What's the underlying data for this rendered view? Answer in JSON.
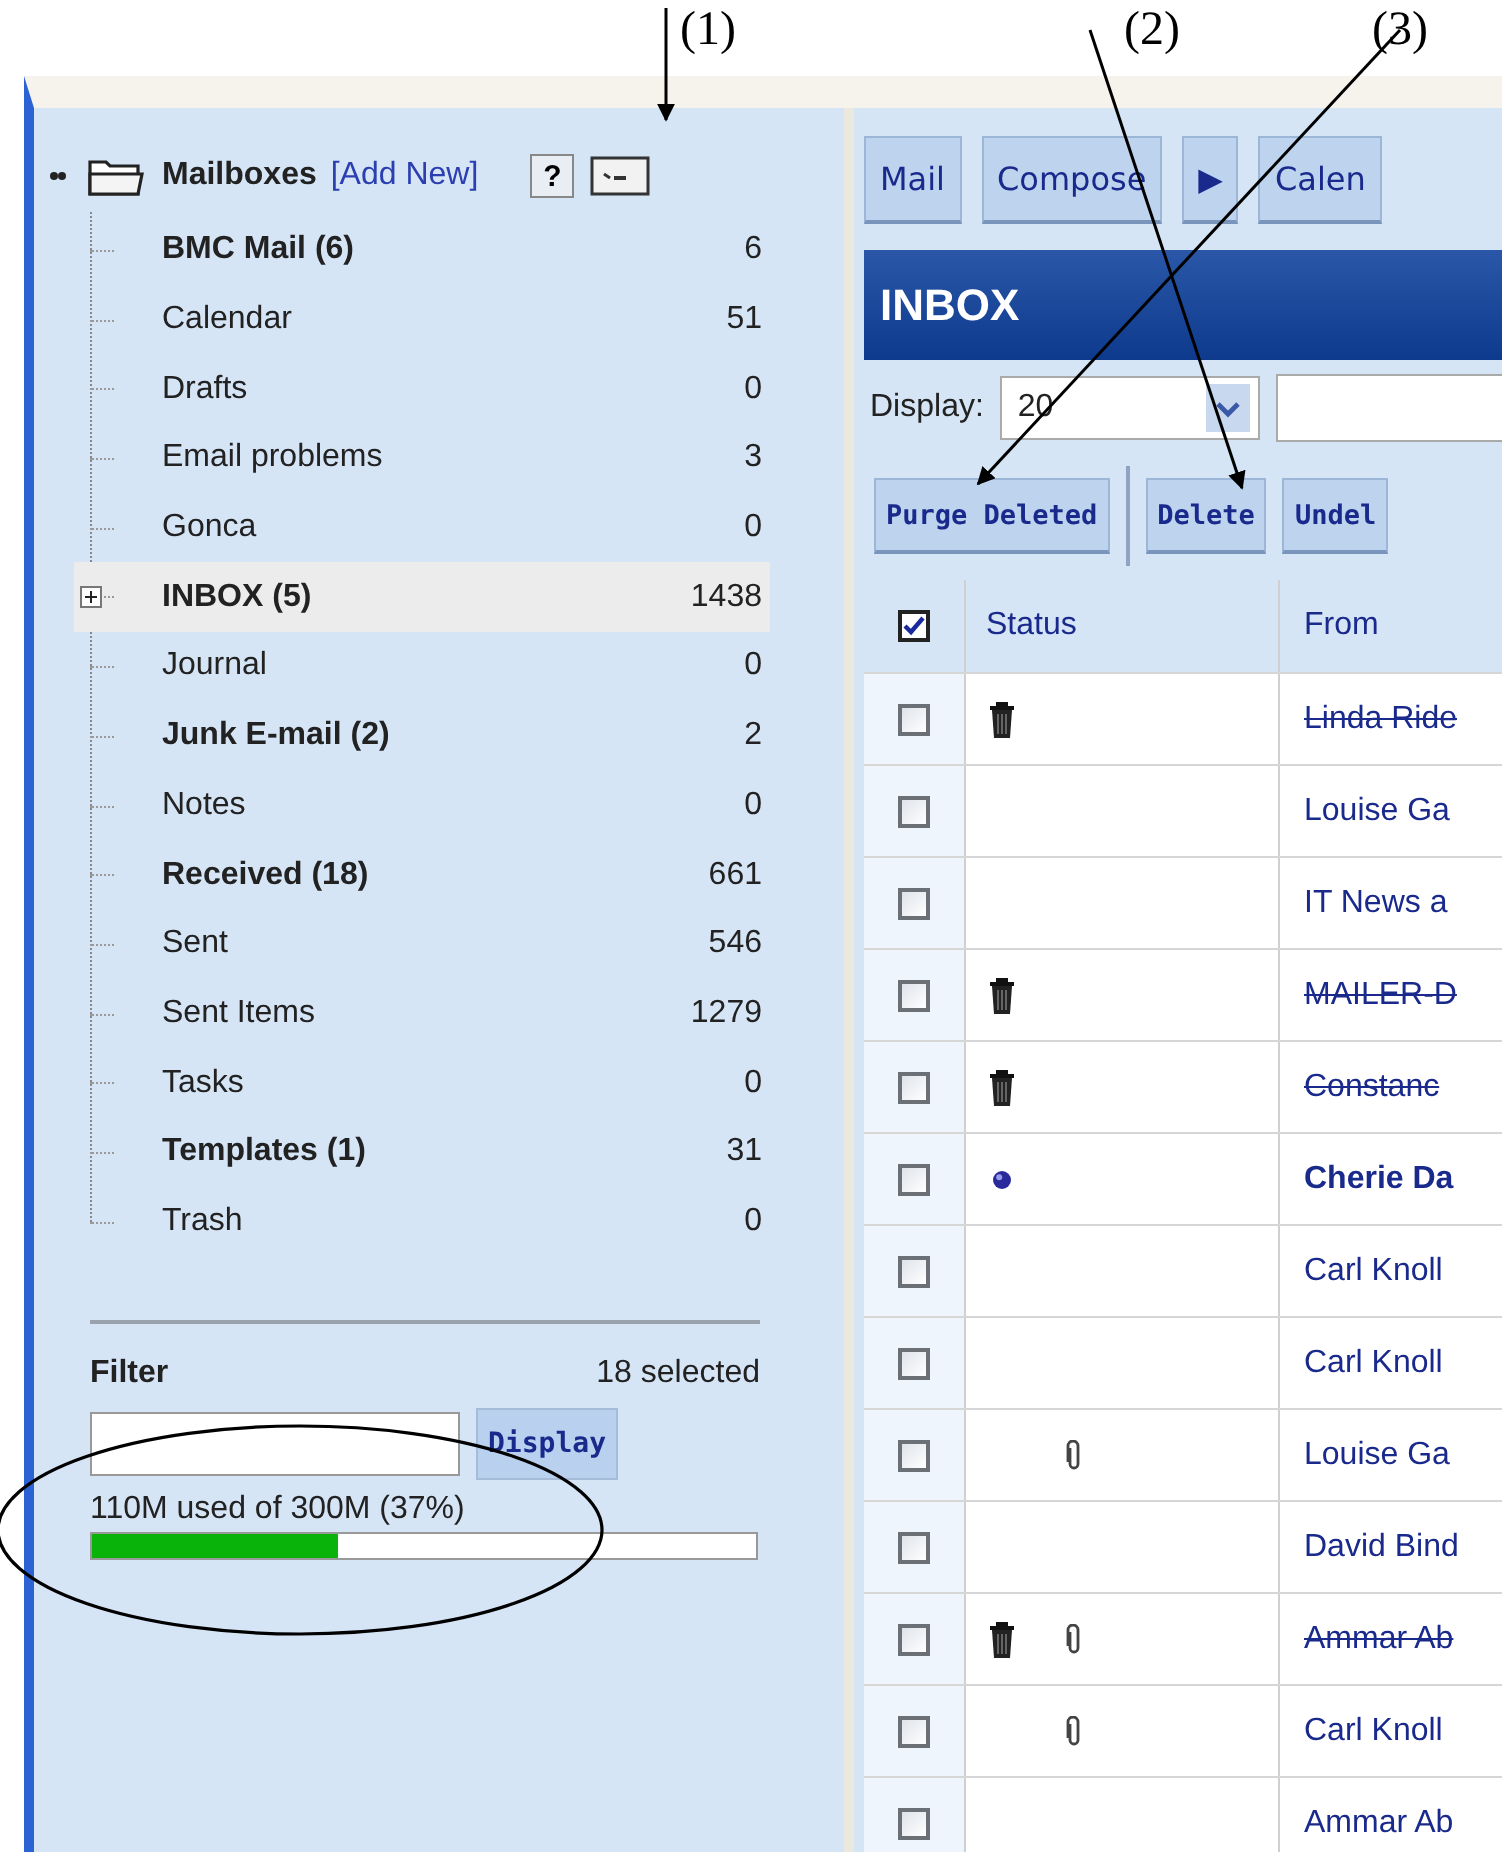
{
  "annotations": [
    {
      "label": "(1)"
    },
    {
      "label": "(2)"
    },
    {
      "label": "(3)"
    }
  ],
  "sidebar": {
    "title": "Mailboxes",
    "add_link": "[Add New]",
    "help_button": "?",
    "mailboxes": [
      {
        "name": "BMC Mail (6)",
        "count": "6",
        "unread": true,
        "selected": false,
        "expandable": false
      },
      {
        "name": "Calendar",
        "count": "51",
        "unread": false,
        "selected": false,
        "expandable": false
      },
      {
        "name": "Drafts",
        "count": "0",
        "unread": false,
        "selected": false,
        "expandable": false
      },
      {
        "name": "Email problems",
        "count": "3",
        "unread": false,
        "selected": false,
        "expandable": false
      },
      {
        "name": "Gonca",
        "count": "0",
        "unread": false,
        "selected": false,
        "expandable": false
      },
      {
        "name": "INBOX (5)",
        "count": "1438",
        "unread": true,
        "selected": true,
        "expandable": true,
        "expanded": false
      },
      {
        "name": "Journal",
        "count": "0",
        "unread": false,
        "selected": false,
        "expandable": false
      },
      {
        "name": "Junk E-mail (2)",
        "count": "2",
        "unread": true,
        "selected": false,
        "expandable": false
      },
      {
        "name": "Notes",
        "count": "0",
        "unread": false,
        "selected": false,
        "expandable": false
      },
      {
        "name": "Received (18)",
        "count": "661",
        "unread": true,
        "selected": false,
        "expandable": false
      },
      {
        "name": "Sent",
        "count": "546",
        "unread": false,
        "selected": false,
        "expandable": false
      },
      {
        "name": "Sent Items",
        "count": "1279",
        "unread": false,
        "selected": false,
        "expandable": false
      },
      {
        "name": "Tasks",
        "count": "0",
        "unread": false,
        "selected": false,
        "expandable": false
      },
      {
        "name": "Templates (1)",
        "count": "31",
        "unread": true,
        "selected": false,
        "expandable": false
      },
      {
        "name": "Trash",
        "count": "0",
        "unread": false,
        "selected": false,
        "expandable": false
      }
    ],
    "filter": {
      "label": "Filter",
      "selected_count": "18 selected",
      "button": "Display"
    },
    "storage": {
      "text": "110M used of 300M  (37%)",
      "level": 0.37
    }
  },
  "nav_tabs": [
    "Mail",
    "Compose",
    "▶",
    "Calen"
  ],
  "inbox": {
    "title": "INBOX",
    "display_label": "Display:",
    "display_value": "20",
    "buttons": [
      "Purge Deleted",
      "Delete",
      "Undel"
    ],
    "columns": [
      "Status",
      "From"
    ],
    "select_all": {
      "checked": true
    },
    "messages": [
      {
        "from": "Linda Ride",
        "deleted": true,
        "unread": false,
        "attachment": false,
        "checked": false
      },
      {
        "from": "Louise Ga",
        "deleted": false,
        "unread": false,
        "attachment": false,
        "checked": false
      },
      {
        "from": "IT News a",
        "deleted": false,
        "unread": false,
        "attachment": false,
        "checked": false
      },
      {
        "from": "MAILER-D",
        "deleted": true,
        "unread": false,
        "attachment": false,
        "checked": false
      },
      {
        "from": "Constanc",
        "deleted": true,
        "unread": false,
        "attachment": false,
        "checked": false
      },
      {
        "from": "Cherie Da",
        "deleted": false,
        "unread": true,
        "attachment": false,
        "checked": false
      },
      {
        "from": "Carl Knoll",
        "deleted": false,
        "unread": false,
        "attachment": false,
        "checked": false
      },
      {
        "from": "Carl Knoll",
        "deleted": false,
        "unread": false,
        "attachment": false,
        "checked": false
      },
      {
        "from": "Louise Ga",
        "deleted": false,
        "unread": false,
        "attachment": true,
        "checked": false
      },
      {
        "from": "David Bind",
        "deleted": false,
        "unread": false,
        "attachment": false,
        "checked": false
      },
      {
        "from": "Ammar Ab",
        "deleted": true,
        "unread": false,
        "attachment": true,
        "checked": false
      },
      {
        "from": "Carl Knoll",
        "deleted": false,
        "unread": false,
        "attachment": true,
        "checked": false
      },
      {
        "from": "Ammar Ab",
        "deleted": false,
        "unread": false,
        "attachment": false,
        "checked": false
      }
    ]
  }
}
